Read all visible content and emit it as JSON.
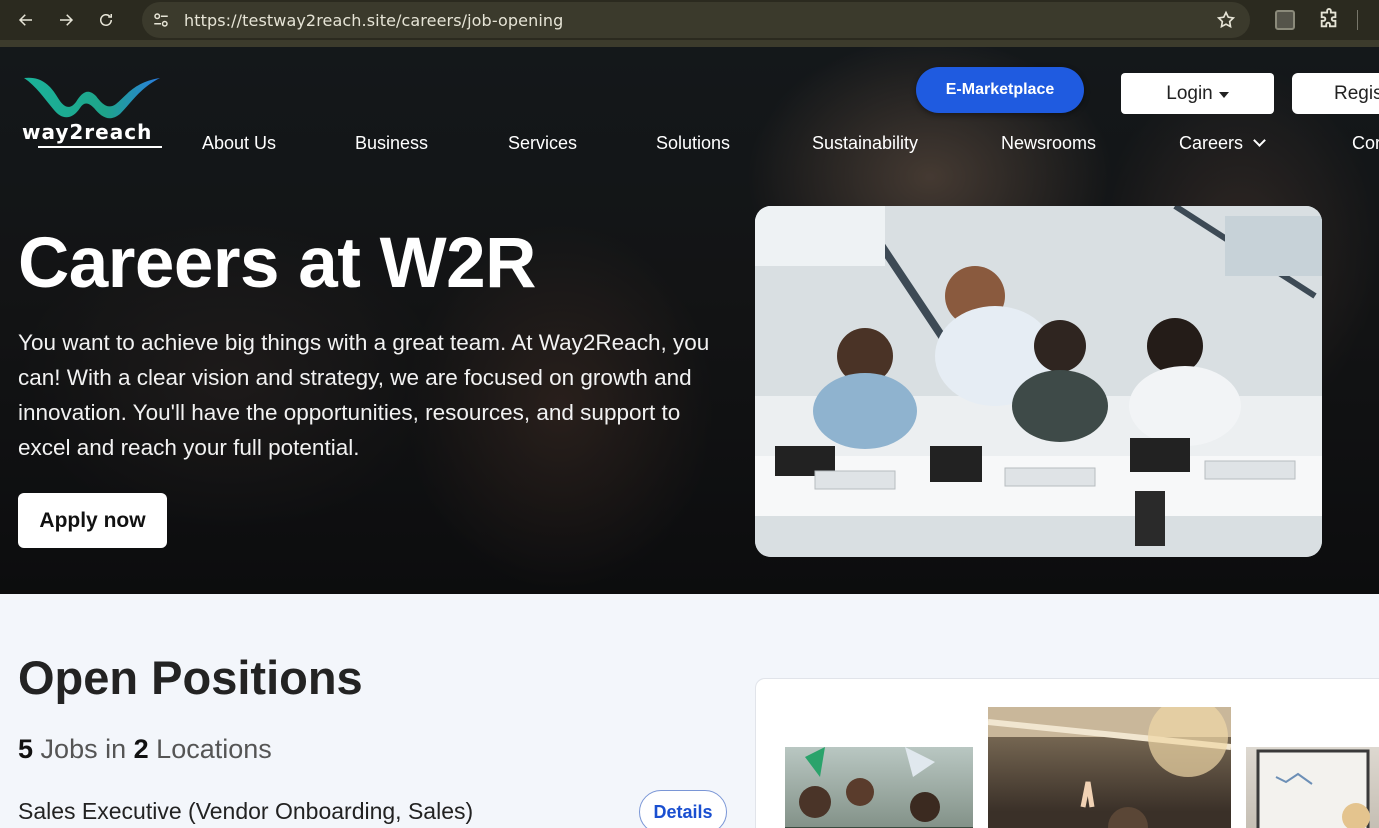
{
  "browser": {
    "url": "https://testway2reach.site/careers/job-opening"
  },
  "header": {
    "logo_text": "way2reach",
    "marketplace_label": "E-Marketplace",
    "login_label": "Login",
    "register_label": "Regis",
    "menu": [
      {
        "label": "About Us"
      },
      {
        "label": "Business"
      },
      {
        "label": "Services"
      },
      {
        "label": "Solutions"
      },
      {
        "label": "Sustainability"
      },
      {
        "label": "Newsrooms"
      },
      {
        "label": "Careers"
      },
      {
        "label": "Cor"
      }
    ]
  },
  "hero": {
    "title": "Careers at W2R",
    "text": "You want to achieve big things with a great team. At Way2Reach, you can! With a clear vision and strategy, we are focused on growth and innovation. You'll have the opportunities, resources, and support to excel and reach your full potential.",
    "apply_label": "Apply now"
  },
  "positions": {
    "title": "Open Positions",
    "jobs_number": "5",
    "jobs_text": "Jobs in",
    "locations_number": "2",
    "locations_text": "Locations",
    "jobs": [
      {
        "title": "Sales Executive (Vendor Onboarding, Sales)",
        "details_label": "Details"
      }
    ]
  },
  "colors": {
    "accent": "#1f5be0",
    "logo_teal": "#1bb39a",
    "logo_blue": "#2a7de1"
  }
}
